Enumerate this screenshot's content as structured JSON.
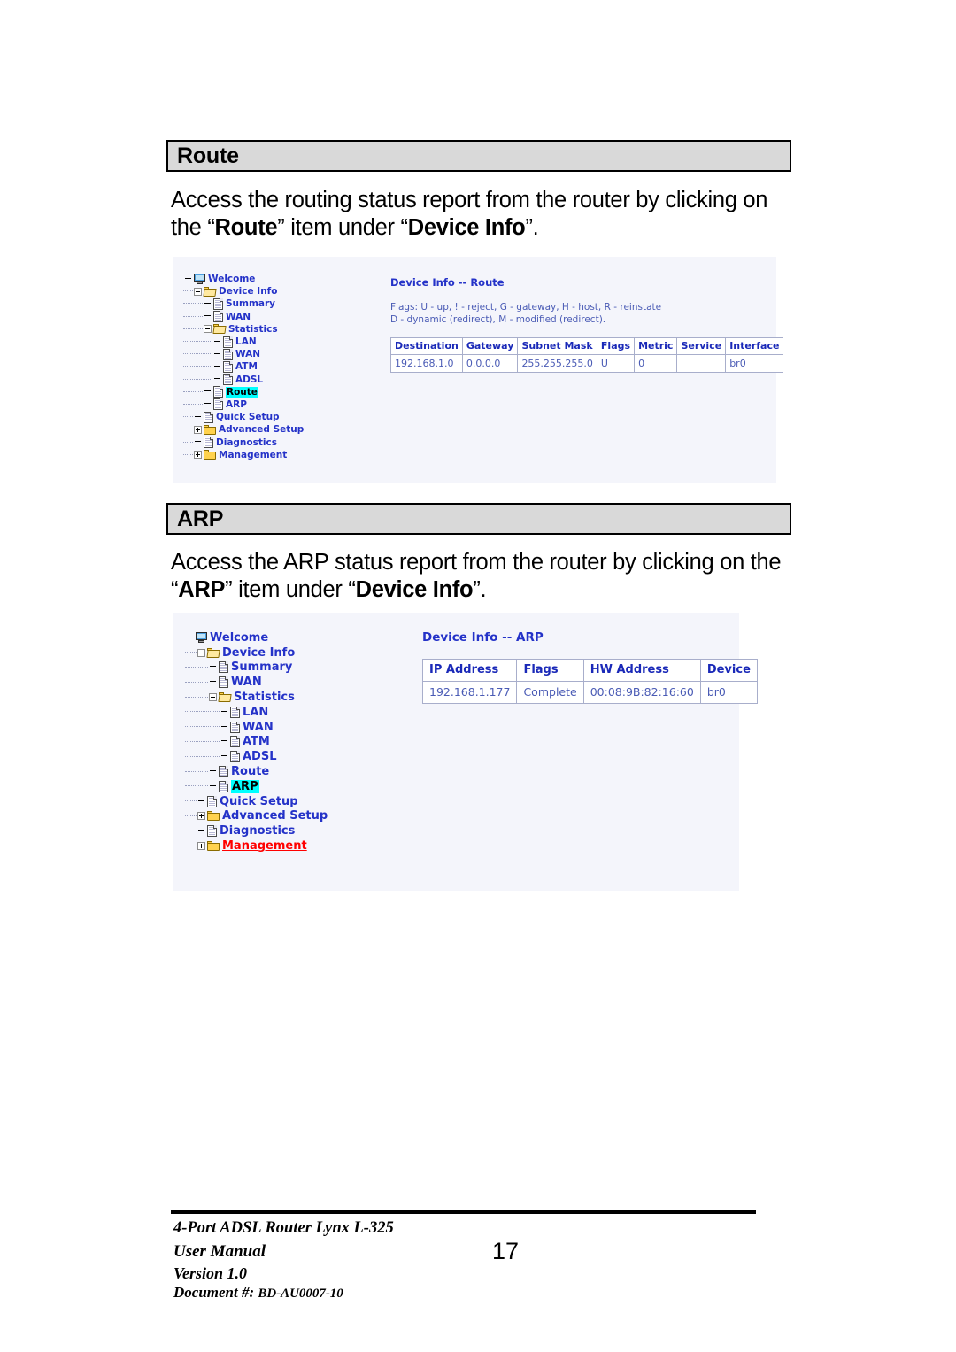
{
  "sections": [
    {
      "id": "route",
      "heading": "Route",
      "paragraph": {
        "pre": "Access the routing status report from the router by clicking on the “",
        "bold1": "Route",
        "mid": "” item under “",
        "bold2": "Device Info",
        "post": "”."
      }
    },
    {
      "id": "arp",
      "heading": "ARP",
      "paragraph": {
        "pre": "Access the ARP status report from the router by clicking on the “",
        "bold1": "ARP",
        "mid": "” item under “",
        "bold2": "Device Info",
        "post": "”."
      }
    }
  ],
  "route_screenshot": {
    "tree": [
      {
        "label": "Welcome",
        "icon": "monitor-icon",
        "depth": 0,
        "expander": "none",
        "state": "normal"
      },
      {
        "label": "Device Info",
        "icon": "folder-open-icon",
        "depth": 1,
        "expander": "minus",
        "state": "normal"
      },
      {
        "label": "Summary",
        "icon": "page-icon",
        "depth": 2,
        "expander": "none",
        "state": "normal"
      },
      {
        "label": "WAN",
        "icon": "page-icon",
        "depth": 2,
        "expander": "none",
        "state": "normal"
      },
      {
        "label": "Statistics",
        "icon": "folder-open-icon",
        "depth": 2,
        "expander": "minus",
        "state": "normal"
      },
      {
        "label": "LAN",
        "icon": "page-icon",
        "depth": 3,
        "expander": "none",
        "state": "normal"
      },
      {
        "label": "WAN",
        "icon": "page-icon",
        "depth": 3,
        "expander": "none",
        "state": "normal"
      },
      {
        "label": "ATM",
        "icon": "page-icon",
        "depth": 3,
        "expander": "none",
        "state": "normal"
      },
      {
        "label": "ADSL",
        "icon": "page-icon",
        "depth": 3,
        "expander": "none",
        "state": "normal"
      },
      {
        "label": "Route",
        "icon": "page-icon",
        "depth": 2,
        "expander": "none",
        "state": "highlighted"
      },
      {
        "label": "ARP",
        "icon": "page-icon",
        "depth": 2,
        "expander": "none",
        "state": "normal"
      },
      {
        "label": "Quick Setup",
        "icon": "page-icon",
        "depth": 1,
        "expander": "none",
        "state": "normal"
      },
      {
        "label": "Advanced Setup",
        "icon": "folder-icon",
        "depth": 1,
        "expander": "plus",
        "state": "normal"
      },
      {
        "label": "Diagnostics",
        "icon": "page-icon",
        "depth": 1,
        "expander": "none",
        "state": "normal"
      },
      {
        "label": "Management",
        "icon": "folder-icon",
        "depth": 1,
        "expander": "plus",
        "state": "normal"
      }
    ],
    "content_title": "Device Info -- Route",
    "flags_note_line1": "Flags: U - up, ! - reject, G - gateway, H - host, R - reinstate",
    "flags_note_line2": "D - dynamic (redirect), M - modified (redirect).",
    "table": {
      "columns": [
        "Destination",
        "Gateway",
        "Subnet Mask",
        "Flags",
        "Metric",
        "Service",
        "Interface"
      ],
      "rows": [
        [
          "192.168.1.0",
          "0.0.0.0",
          "255.255.255.0",
          "U",
          "0",
          "",
          "br0"
        ]
      ]
    }
  },
  "arp_screenshot": {
    "tree": [
      {
        "label": "Welcome",
        "icon": "monitor-icon",
        "depth": 0,
        "expander": "none",
        "state": "normal"
      },
      {
        "label": "Device Info",
        "icon": "folder-open-icon",
        "depth": 1,
        "expander": "minus",
        "state": "normal"
      },
      {
        "label": "Summary",
        "icon": "page-icon",
        "depth": 2,
        "expander": "none",
        "state": "normal"
      },
      {
        "label": "WAN",
        "icon": "page-icon",
        "depth": 2,
        "expander": "none",
        "state": "normal"
      },
      {
        "label": "Statistics",
        "icon": "folder-open-icon",
        "depth": 2,
        "expander": "minus",
        "state": "normal"
      },
      {
        "label": "LAN",
        "icon": "page-icon",
        "depth": 3,
        "expander": "none",
        "state": "normal"
      },
      {
        "label": "WAN",
        "icon": "page-icon",
        "depth": 3,
        "expander": "none",
        "state": "normal"
      },
      {
        "label": "ATM",
        "icon": "page-icon",
        "depth": 3,
        "expander": "none",
        "state": "normal"
      },
      {
        "label": "ADSL",
        "icon": "page-icon",
        "depth": 3,
        "expander": "none",
        "state": "normal"
      },
      {
        "label": "Route",
        "icon": "page-icon",
        "depth": 2,
        "expander": "none",
        "state": "normal"
      },
      {
        "label": "ARP",
        "icon": "page-icon",
        "depth": 2,
        "expander": "none",
        "state": "highlighted"
      },
      {
        "label": "Quick Setup",
        "icon": "page-icon",
        "depth": 1,
        "expander": "none",
        "state": "normal"
      },
      {
        "label": "Advanced Setup",
        "icon": "folder-icon",
        "depth": 1,
        "expander": "plus",
        "state": "normal"
      },
      {
        "label": "Diagnostics",
        "icon": "page-icon",
        "depth": 1,
        "expander": "none",
        "state": "normal"
      },
      {
        "label": "Management",
        "icon": "folder-icon",
        "depth": 1,
        "expander": "plus",
        "state": "active"
      }
    ],
    "content_title": "Device Info -- ARP",
    "table": {
      "columns": [
        "IP Address",
        "Flags",
        "HW Address",
        "Device"
      ],
      "rows": [
        [
          "192.168.1.177",
          "Complete",
          "00:08:9B:82:16:60",
          "br0"
        ]
      ]
    }
  },
  "footer": {
    "line1": "4-Port ADSL Router Lynx L-325",
    "line2": "User Manual",
    "line3": "Version 1.0",
    "line4_label": "Document #:",
    "line4_value": "BD-AU0007-10",
    "page_number": "17"
  },
  "colors": {
    "highlight": "#00ffff",
    "link": "#2432c8",
    "active_link": "#ff0000",
    "panel_bg": "#f4f5fb",
    "section_bar": "#d9d9d9"
  }
}
